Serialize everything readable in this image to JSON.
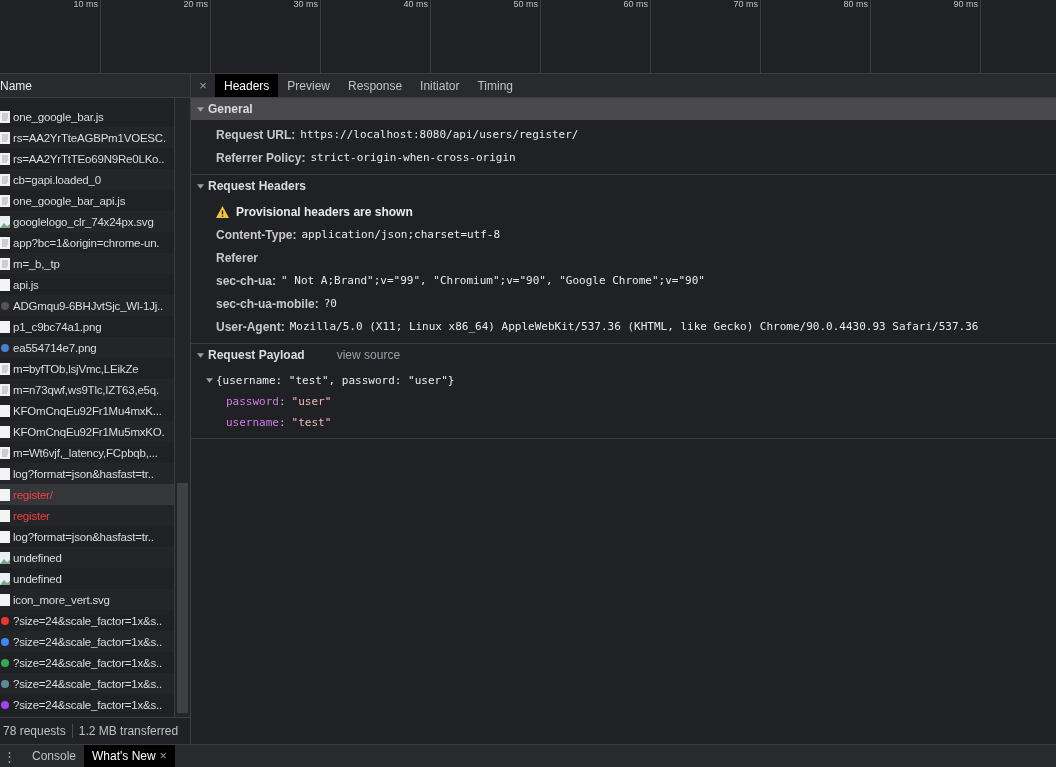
{
  "timeline": {
    "ticks": [
      "10 ms",
      "20 ms",
      "30 ms",
      "40 ms",
      "50 ms",
      "60 ms",
      "70 ms",
      "80 ms",
      "90 ms"
    ]
  },
  "requests": {
    "header": "Name",
    "rows": [
      {
        "name": "one_google_bar.js",
        "kind": "doc",
        "error": false,
        "selected": false
      },
      {
        "name": "rs=AA2YrTteAGBPm1VOESC.",
        "kind": "doc",
        "error": false,
        "selected": false
      },
      {
        "name": "rs=AA2YrTtTEo69N9Re0LKo..",
        "kind": "doc",
        "error": false,
        "selected": false
      },
      {
        "name": "cb=gapi.loaded_0",
        "kind": "doc",
        "error": false,
        "selected": false
      },
      {
        "name": "one_google_bar_api.js",
        "kind": "doc",
        "error": false,
        "selected": false
      },
      {
        "name": "googlelogo_clr_74x24px.svg",
        "kind": "image",
        "error": false,
        "selected": false
      },
      {
        "name": "app?bc=1&origin=chrome-un.",
        "kind": "doc",
        "error": false,
        "selected": false
      },
      {
        "name": "m=_b,_tp",
        "kind": "doc",
        "error": false,
        "selected": false
      },
      {
        "name": "api.js",
        "kind": "blank",
        "error": false,
        "selected": false
      },
      {
        "name": "ADGmqu9-6BHJvtSjc_Wl-1Jj..",
        "kind": "favicon",
        "color": "#555555",
        "error": false,
        "selected": false
      },
      {
        "name": "p1_c9bc74a1.png",
        "kind": "blank",
        "error": false,
        "selected": false
      },
      {
        "name": "ea554714e7.png",
        "kind": "favicon",
        "color": "#4a7fd4",
        "error": false,
        "selected": false
      },
      {
        "name": "m=byfTOb,lsjVmc,LEikZe",
        "kind": "doc",
        "error": false,
        "selected": false
      },
      {
        "name": "m=n73qwf,ws9Tlc,IZT63,e5q.",
        "kind": "doc",
        "error": false,
        "selected": false
      },
      {
        "name": "KFOmCnqEu92Fr1Mu4mxK...",
        "kind": "blank",
        "error": false,
        "selected": false
      },
      {
        "name": "KFOmCnqEu92Fr1Mu5mxKO.",
        "kind": "blank",
        "error": false,
        "selected": false
      },
      {
        "name": "m=Wt6vjf,_latency,FCpbqb,...",
        "kind": "doc",
        "error": false,
        "selected": false
      },
      {
        "name": "log?format=json&hasfast=tr..",
        "kind": "blank",
        "error": false,
        "selected": false
      },
      {
        "name": "register/",
        "kind": "blank",
        "error": true,
        "selected": true
      },
      {
        "name": "register",
        "kind": "blank",
        "error": true,
        "selected": false
      },
      {
        "name": "log?format=json&hasfast=tr..",
        "kind": "blank",
        "error": false,
        "selected": false
      },
      {
        "name": "undefined",
        "kind": "image",
        "error": false,
        "selected": false
      },
      {
        "name": "undefined",
        "kind": "image",
        "error": false,
        "selected": false
      },
      {
        "name": "icon_more_vert.svg",
        "kind": "blank",
        "error": false,
        "selected": false
      },
      {
        "name": "?size=24&scale_factor=1x&s..",
        "kind": "favicon",
        "color": "#e53935",
        "error": false,
        "selected": false
      },
      {
        "name": "?size=24&scale_factor=1x&s..",
        "kind": "favicon",
        "color": "#4285f4",
        "error": false,
        "selected": false
      },
      {
        "name": "?size=24&scale_factor=1x&s..",
        "kind": "favicon",
        "color": "#34a853",
        "error": false,
        "selected": false
      },
      {
        "name": "?size=24&scale_factor=1x&s..",
        "kind": "favicon",
        "color": "#5f8a9a",
        "error": false,
        "selected": false
      },
      {
        "name": "?size=24&scale_factor=1x&s..",
        "kind": "favicon",
        "color": "#a142f4",
        "error": false,
        "selected": false
      }
    ],
    "summary": [
      "78 requests",
      "1.2 MB transferred"
    ]
  },
  "details": {
    "close": "×",
    "tabs": [
      {
        "label": "Headers",
        "selected": true
      },
      {
        "label": "Preview",
        "selected": false
      },
      {
        "label": "Response",
        "selected": false
      },
      {
        "label": "Initiator",
        "selected": false
      },
      {
        "label": "Timing",
        "selected": false
      }
    ],
    "sections": [
      {
        "kind": "headers",
        "title": "General",
        "expanded": true,
        "focused": true,
        "headers": [
          {
            "name": "Request URL:",
            "value": "https://localhost:8080/api/users/register/"
          },
          {
            "name": "Referrer Policy:",
            "value": "strict-origin-when-cross-origin"
          }
        ]
      },
      {
        "kind": "headers",
        "title": "Request Headers",
        "expanded": true,
        "focused": false,
        "notice": "Provisional headers are shown",
        "headers": [
          {
            "name": "Content-Type:",
            "value": "application/json;charset=utf-8"
          },
          {
            "name": "Referer"
          },
          {
            "name": "sec-ch-ua:",
            "value": "\" Not A;Brand\";v=\"99\", \"Chromium\";v=\"90\", \"Google Chrome\";v=\"90\""
          },
          {
            "name": "sec-ch-ua-mobile:",
            "value": "?0"
          },
          {
            "name": "User-Agent:",
            "value": "Mozilla/5.0 (X11; Linux x86_64) AppleWebKit/537.36 (KHTML, like Gecko) Chrome/90.0.4430.93 Safari/537.36"
          }
        ]
      },
      {
        "kind": "payload",
        "title": "Request Payload",
        "expanded": true,
        "focused": false,
        "link": "view source",
        "object": {
          "summary": "{username: \"test\", password: \"user\"}",
          "expanded": true,
          "properties": [
            {
              "key": "password",
              "separator": ":",
              "value": "\"user\""
            },
            {
              "key": "username",
              "separator": ":",
              "value": "\"test\""
            }
          ]
        }
      }
    ]
  },
  "drawer": {
    "menu": "⋮",
    "tabs": [
      {
        "label": "Console",
        "selected": false
      },
      {
        "label": "What's New",
        "selected": true,
        "close": "×"
      }
    ]
  }
}
